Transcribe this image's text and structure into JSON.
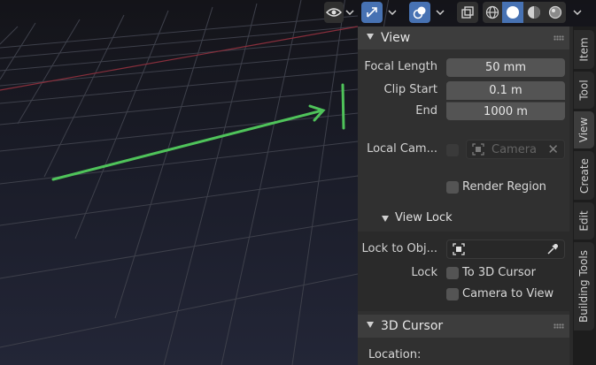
{
  "header": {
    "icons": [
      "visibility-eye-icon",
      "gizmo-arrows-icon",
      "overlay-spheres-icon",
      "xray-toggle-icon",
      "wireframe-shading-icon",
      "solid-shading-icon",
      "material-shading-icon",
      "rendered-shading-icon"
    ]
  },
  "view_panel": {
    "title": "View",
    "focal_length": {
      "label": "Focal Length",
      "value": "50 mm"
    },
    "clip_start": {
      "label": "Clip Start",
      "value": "0.1 m"
    },
    "clip_end": {
      "label": "End",
      "value": "1000 m"
    },
    "local_camera": {
      "label": "Local Cam...",
      "placeholder": "Camera"
    },
    "render_region": {
      "label": "Render Region"
    }
  },
  "view_lock": {
    "title": "View Lock",
    "lock_to_object": {
      "label": "Lock to Obj..."
    },
    "lock_label": "Lock",
    "to_3d_cursor": "To 3D Cursor",
    "camera_to_view": "Camera to View"
  },
  "cursor_panel": {
    "title": "3D Cursor",
    "location_label": "Location:"
  },
  "tabs": [
    "Item",
    "Tool",
    "View",
    "Create",
    "Edit",
    "Building Tools"
  ],
  "active_tab": "View",
  "colors": {
    "accent_blue": "#4772b3",
    "annotation_green": "#4fc35a",
    "x_axis_red": "#8a2f3c"
  }
}
